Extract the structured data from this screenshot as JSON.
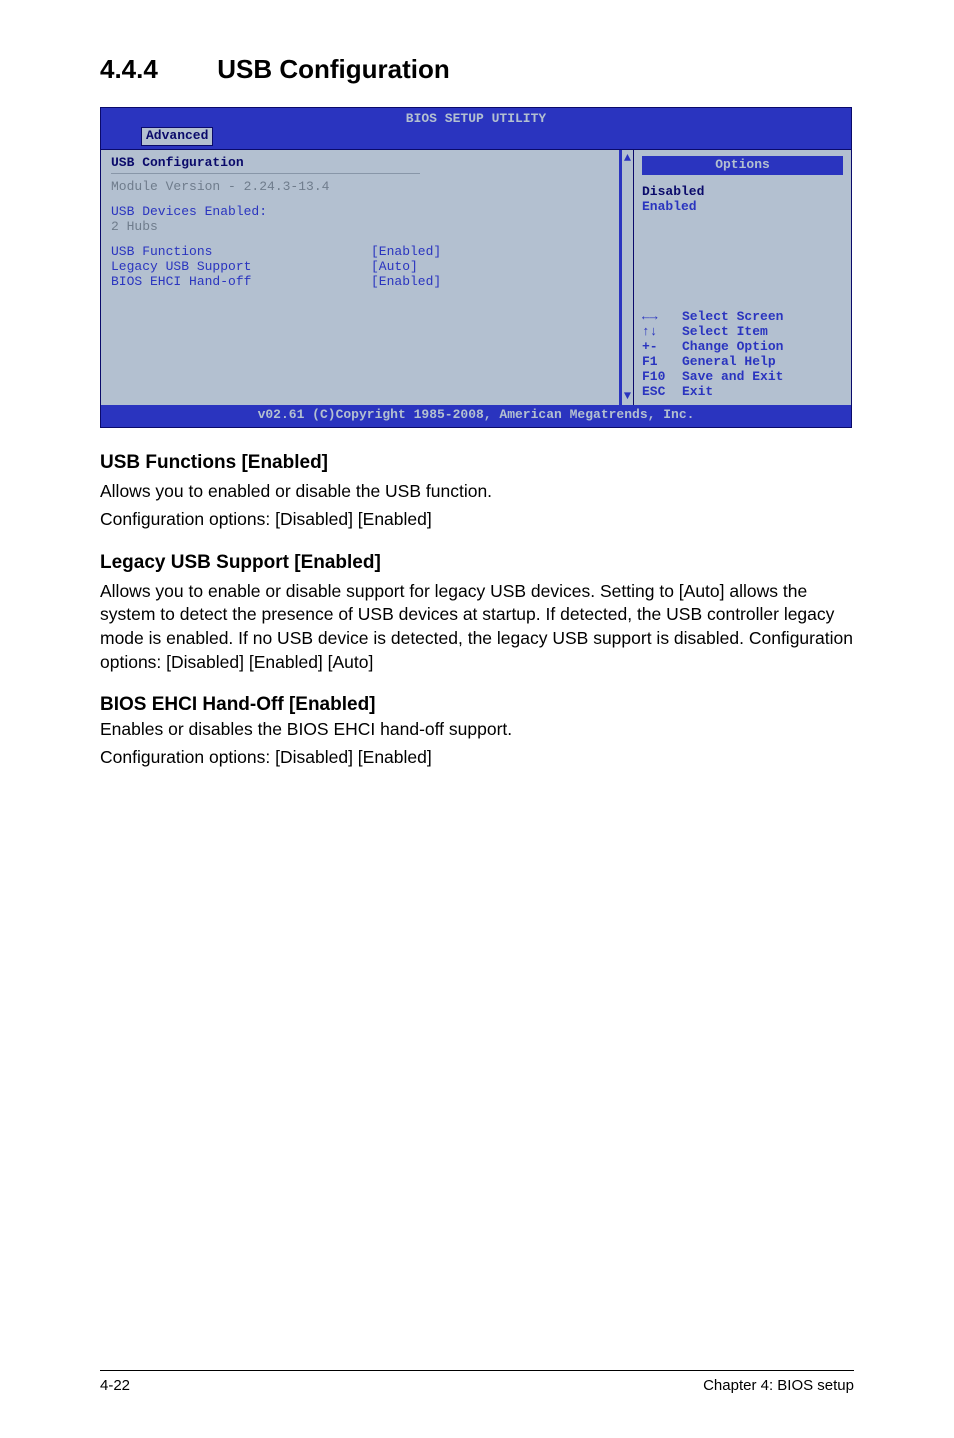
{
  "heading": {
    "number": "4.4.4",
    "title": "USB Configuration"
  },
  "bios": {
    "utility_title": "BIOS SETUP UTILITY",
    "tab": "Advanced",
    "panel_title": "USB Configuration",
    "module_line": "Module Version - 2.24.3-13.4",
    "devices_label": "USB Devices Enabled:",
    "devices_line": " 2 Hubs",
    "settings": [
      {
        "label": "USB Functions",
        "value": "[Enabled]"
      },
      {
        "label": "Legacy USB Support",
        "value": "[Auto]"
      },
      {
        "label": "BIOS EHCI Hand-off",
        "value": "[Enabled]"
      }
    ],
    "options_header": "Options",
    "options": [
      {
        "text": "Disabled",
        "cls": "opt-dark"
      },
      {
        "text": "Enabled",
        "cls": "opt-blue"
      }
    ],
    "keyhelp": [
      {
        "k": "←→",
        "d": "Select Screen"
      },
      {
        "k": "↑↓",
        "d": "Select Item"
      },
      {
        "k": "+-",
        "d": "Change Option"
      },
      {
        "k": "F1",
        "d": "General Help"
      },
      {
        "k": "F10",
        "d": "Save and Exit"
      },
      {
        "k": "ESC",
        "d": "Exit"
      }
    ],
    "footer": "v02.61 (C)Copyright 1985-2008, American Megatrends, Inc."
  },
  "sections": {
    "usb_functions": {
      "h": "USB Functions [Enabled]",
      "p1": "Allows you to enabled or disable the USB function.",
      "p2": "Configuration options: [Disabled] [Enabled]"
    },
    "legacy": {
      "h": "Legacy USB Support [Enabled]",
      "p": "Allows you to enable or disable support for legacy USB devices. Setting to [Auto] allows the system to detect the presence of USB devices at startup. If detected, the USB controller legacy mode is enabled. If no USB device is detected, the legacy USB support is disabled. Configuration options: [Disabled] [Enabled] [Auto]"
    },
    "ehci": {
      "h": "BIOS EHCI Hand-Off [Enabled]",
      "p1": "Enables or disables the BIOS EHCI hand-off support.",
      "p2": "Configuration options: [Disabled] [Enabled]"
    }
  },
  "footer": {
    "left": "4-22",
    "right": "Chapter 4: BIOS setup"
  }
}
